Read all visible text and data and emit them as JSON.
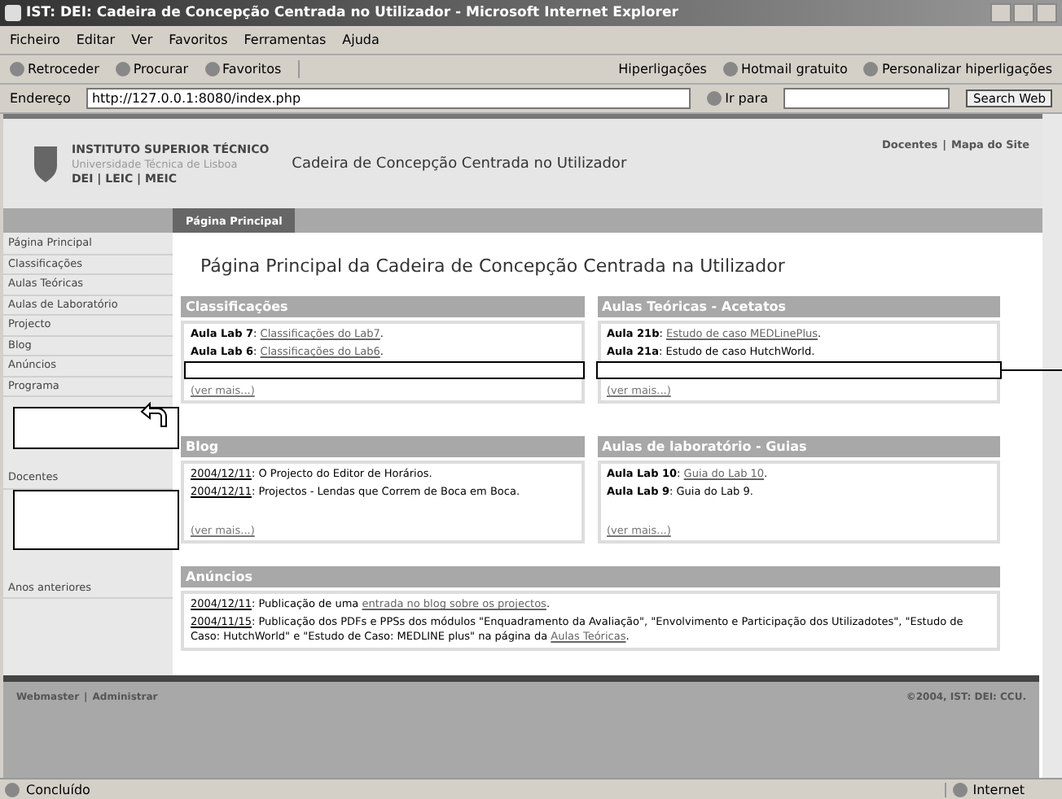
{
  "window": {
    "title": "IST: DEI: Cadeira de Concepção Centrada no Utilizador - Microsoft Internet Explorer"
  },
  "menu": [
    "Ficheiro",
    "Editar",
    "Ver",
    "Favoritos",
    "Ferramentas",
    "Ajuda"
  ],
  "toolbar": {
    "buttons": [
      "Retroceder",
      "Procurar",
      "Favoritos"
    ],
    "links_label": "Hiperligações",
    "links": [
      "Hotmail gratuito",
      "Personalizar hiperligações"
    ]
  },
  "address_bar": {
    "label": "Endereço",
    "url": "http://127.0.0.1:8080/index.php",
    "go": "Ir para",
    "search_button": "Search Web"
  },
  "header": {
    "institute": "INSTITUTO SUPERIOR TÉCNICO",
    "university": "Universidade Técnica de Lisboa",
    "departments": "DEI | LEIC | MEIC",
    "course_title": "Cadeira de Concepção Centrada no Utilizador",
    "top_links": [
      "Docentes",
      "Mapa do Site"
    ],
    "separator": "|"
  },
  "nav_tabs": [
    {
      "label": "Página Principal",
      "selected": true
    }
  ],
  "sidebar": {
    "groups": [
      [
        {
          "label": "Página Principal"
        },
        {
          "label": "Classificações"
        },
        {
          "label": "Aulas Teóricas"
        },
        {
          "label": "Aulas de Laboratório"
        },
        {
          "label": "Projecto"
        },
        {
          "label": "Blog"
        },
        {
          "label": "Anúncios"
        },
        {
          "label": "Programa"
        }
      ],
      [
        {
          "label": "Docentes"
        }
      ],
      [
        {
          "label": "Anos anteriores"
        }
      ]
    ]
  },
  "page_title": "Página Principal da Cadeira de Concepção Centrada na Utilizador",
  "panels": [
    {
      "title": "Classificações",
      "kind": "labels",
      "entries": [
        {
          "lead": "Aula Lab 7",
          "text": ": ",
          "link": "Classificações do Lab7",
          "after": "."
        },
        {
          "lead": "Aula Lab 6",
          "text": ": ",
          "link": "Classificações do Lab6",
          "after": "."
        }
      ],
      "more": "(ver mais...)"
    },
    {
      "title": "Aulas Teóricas - Acetatos",
      "kind": "labels",
      "entries": [
        {
          "lead": "Aula 21b",
          "text": ": ",
          "link": "Estudo de caso MEDLinePlus",
          "after": "."
        },
        {
          "lead": "Aula 21a",
          "text": ": Estudo de caso HutchWorld."
        }
      ],
      "more": "(ver mais...)"
    },
    {
      "title": "Blog",
      "kind": "dates",
      "entries": [
        {
          "lead": "2004/12/11",
          "text": ": O Projecto do Editor de Horários."
        },
        {
          "lead": "2004/12/11",
          "text": ": Projectos - Lendas que Correm de Boca em Boca."
        }
      ],
      "more": "(ver mais...)"
    },
    {
      "title": "Aulas de laboratório - Guias",
      "kind": "labels",
      "entries": [
        {
          "lead": "Aula Lab 10",
          "text": ": ",
          "link": "Guia do Lab 10",
          "after": "."
        },
        {
          "lead": "Aula Lab 9",
          "text": ": Guia do Lab 9."
        }
      ],
      "more": "(ver mais...)"
    }
  ],
  "announcements": {
    "title": "Anúncios",
    "kind": "dates",
    "entries": [
      {
        "lead": "2004/12/11",
        "text": ": Publicação de uma ",
        "link": "entrada no blog sobre os projectos",
        "after": "."
      },
      {
        "lead": "2004/11/15",
        "text": ": Publicação dos PDFs e PPSs dos módulos \"Enquadramento da Avaliação\", \"Envolvimento e Participação dos Utilizadotes\", \"Estudo de Caso: HutchWorld\" e \"Estudo de Caso: MEDLINE plus\" na página da ",
        "link": "Aulas Teóricas",
        "after": "."
      }
    ]
  },
  "footer": {
    "links": [
      "Webmaster",
      "Administrar"
    ],
    "separator": "|",
    "copyright": "©2004, IST: DEI: CCU."
  },
  "status_bar": {
    "text": "Concluído",
    "zone": "Internet"
  }
}
